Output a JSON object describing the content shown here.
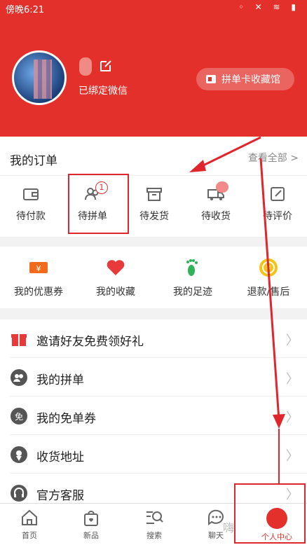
{
  "status_bar": {
    "time": "傍晚6:21"
  },
  "profile": {
    "bound_text": "已绑定微信",
    "collect_button": "拼单卡收藏馆"
  },
  "orders": {
    "title": "我的订单",
    "view_all": "查看全部 >",
    "items": [
      {
        "label": "待付款",
        "icon": "wallet-icon"
      },
      {
        "label": "待拼单",
        "icon": "group-icon",
        "badge": "1"
      },
      {
        "label": "待发货",
        "icon": "box-icon"
      },
      {
        "label": "待收货",
        "icon": "truck-icon"
      },
      {
        "label": "待评价",
        "icon": "edit-icon"
      }
    ]
  },
  "tools": [
    {
      "label": "我的优惠券",
      "icon": "coupon-icon",
      "color": "#f26a1b"
    },
    {
      "label": "我的收藏",
      "icon": "heart-icon",
      "color": "#e83a3a"
    },
    {
      "label": "我的足迹",
      "icon": "footprint-icon",
      "color": "#2eb35a"
    },
    {
      "label": "退款/售后",
      "icon": "refund-icon",
      "color": "#f2c418"
    }
  ],
  "menu": [
    {
      "label": "邀请好友免费领好礼",
      "icon": "gift-icon"
    },
    {
      "label": "我的拼单",
      "icon": "group-icon"
    },
    {
      "label": "我的免单券",
      "icon": "free-coupon-icon"
    },
    {
      "label": "收货地址",
      "icon": "location-icon"
    },
    {
      "label": "官方客服",
      "icon": "headset-icon"
    }
  ],
  "tabbar": [
    {
      "label": "首页",
      "icon": "home-icon"
    },
    {
      "label": "新品",
      "icon": "bag-icon"
    },
    {
      "label": "搜索",
      "icon": "search-icon"
    },
    {
      "label": "聊天",
      "icon": "chat-icon"
    },
    {
      "label": "个人中心",
      "icon": "profile-icon",
      "active": true
    }
  ],
  "colors": {
    "brand": "#e3302b",
    "highlight": "#e0262d"
  },
  "watermark": "嗨"
}
